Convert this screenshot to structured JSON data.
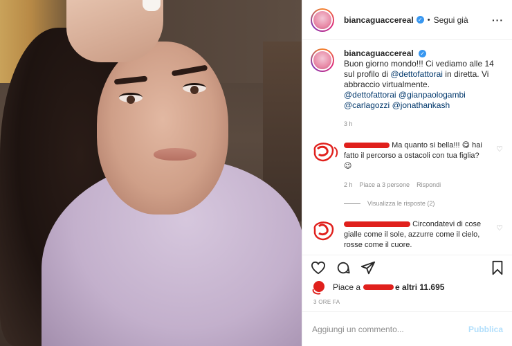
{
  "post": {
    "username": "biancaguaccereal",
    "follow_separator": "•",
    "follow_label": "Segui già",
    "more_icon": "more-horizontal-icon",
    "caption_lines": {
      "intro": "Buon giorno mondo!!! Ci vediamo alle 14 sul profilo di",
      "mention1": "@dettofattorai",
      "mid": "in diretta. Vi abbraccio virtualmente.",
      "mention2": "@dettofattorai",
      "mention3": "@gianpaologambi",
      "mention4": "@carlagozzi",
      "mention5": "@jonathankash"
    },
    "caption_time": "3 h"
  },
  "comments": [
    {
      "text": "Ma quanto si bella!!! 😋 hai fatto il percorso a ostacoli con tua figlia? 😉",
      "time": "2 h",
      "likes": "Piace a 3 persone",
      "reply": "Rispondi",
      "view_replies": "Visualizza le risposte (2)"
    },
    {
      "text": "Circondatevi di cose gialle come il sole, azzurre come il cielo, rosse come il cuore."
    }
  ],
  "likes": {
    "prefix": "Piace a",
    "suffix": "e altri 11.695"
  },
  "time_ago": "3 ORE FA",
  "add_comment": {
    "placeholder": "Aggiungi un commento...",
    "publish_label": "Pubblica"
  },
  "colors": {
    "accent_link": "#00376b",
    "verified": "#3897f0",
    "redaction": "#e0201c",
    "publish_disabled": "#b2dffc"
  }
}
